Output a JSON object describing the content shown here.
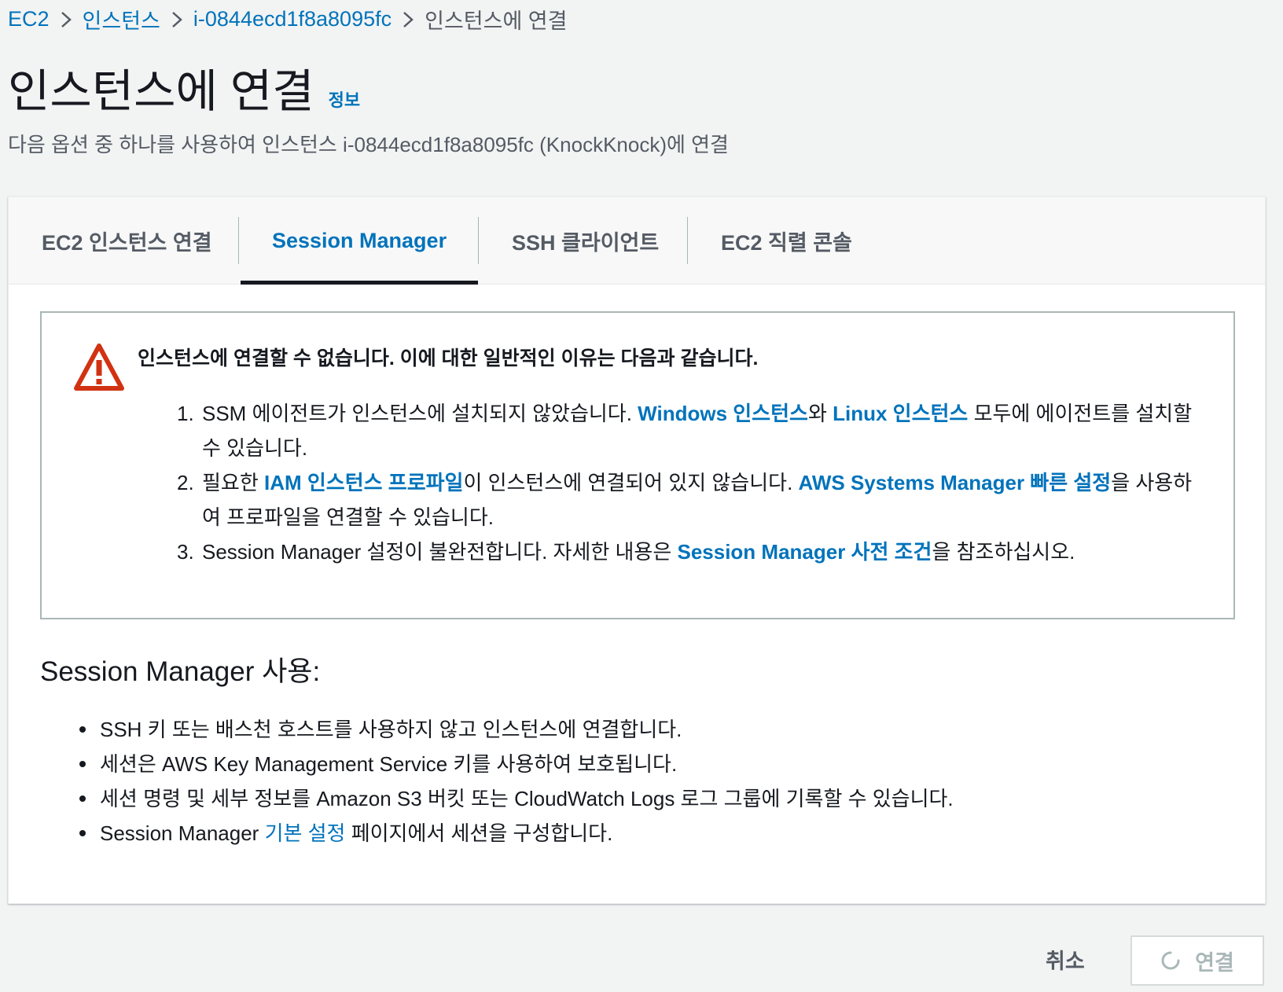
{
  "breadcrumb": {
    "items": [
      "EC2",
      "인스턴스",
      "i-0844ecd1f8a8095fc"
    ],
    "current": "인스턴스에 연결"
  },
  "page": {
    "title": "인스턴스에 연결",
    "info_label": "정보",
    "description": "다음 옵션 중 하나를 사용하여 인스턴스 i-0844ecd1f8a8095fc (KnockKnock)에 연결"
  },
  "tabs": [
    {
      "label": "EC2 인스턴스 연결",
      "active": false
    },
    {
      "label": "Session Manager",
      "active": true
    },
    {
      "label": "SSH 클라이언트",
      "active": false
    },
    {
      "label": "EC2 직렬 콘솔",
      "active": false
    }
  ],
  "alert": {
    "header": "인스턴스에 연결할 수 없습니다. 이에 대한 일반적인 이유는 다음과 같습니다.",
    "items": [
      {
        "num": "1.",
        "pre": "SSM 에이전트가 인스턴스에 설치되지 않았습니다. ",
        "link1": "Windows 인스턴스",
        "mid": "와 ",
        "link2": "Linux 인스턴스",
        "post": " 모두에 에이전트를 설치할 수 있습니다."
      },
      {
        "num": "2.",
        "pre": "필요한 ",
        "link1": "IAM 인스턴스 프로파일",
        "mid": "이 인스턴스에 연결되어 있지 않습니다. ",
        "link2": "AWS Systems Manager 빠른 설정",
        "post": "을 사용하여 프로파일을 연결할 수 있습니다."
      },
      {
        "num": "3.",
        "pre": "Session Manager 설정이 불완전합니다. 자세한 내용은 ",
        "link1": "Session Manager 사전 조건",
        "post": "을 참조하십시오."
      }
    ]
  },
  "session_manager": {
    "heading": "Session Manager 사용:",
    "items": [
      {
        "text": "SSH 키 또는 배스천 호스트를 사용하지 않고 인스턴스에 연결합니다."
      },
      {
        "text": "세션은 AWS Key Management Service 키를 사용하여 보호됩니다."
      },
      {
        "text": "세션 명령 및 세부 정보를 Amazon S3 버킷 또는 CloudWatch Logs 로그 그룹에 기록할 수 있습니다."
      },
      {
        "pre": "Session Manager ",
        "link": "기본 설정",
        "post": " 페이지에서 세션을 구성합니다."
      }
    ]
  },
  "footer": {
    "cancel_label": "취소",
    "connect_label": "연결"
  },
  "colors": {
    "link": "#0073bb",
    "alert_icon": "#d13212",
    "background": "#f2f3f3"
  },
  "icons": {
    "breadcrumb_separator": "chevron-right-icon",
    "alert": "warning-icon",
    "connect_loading": "spinner-icon"
  }
}
